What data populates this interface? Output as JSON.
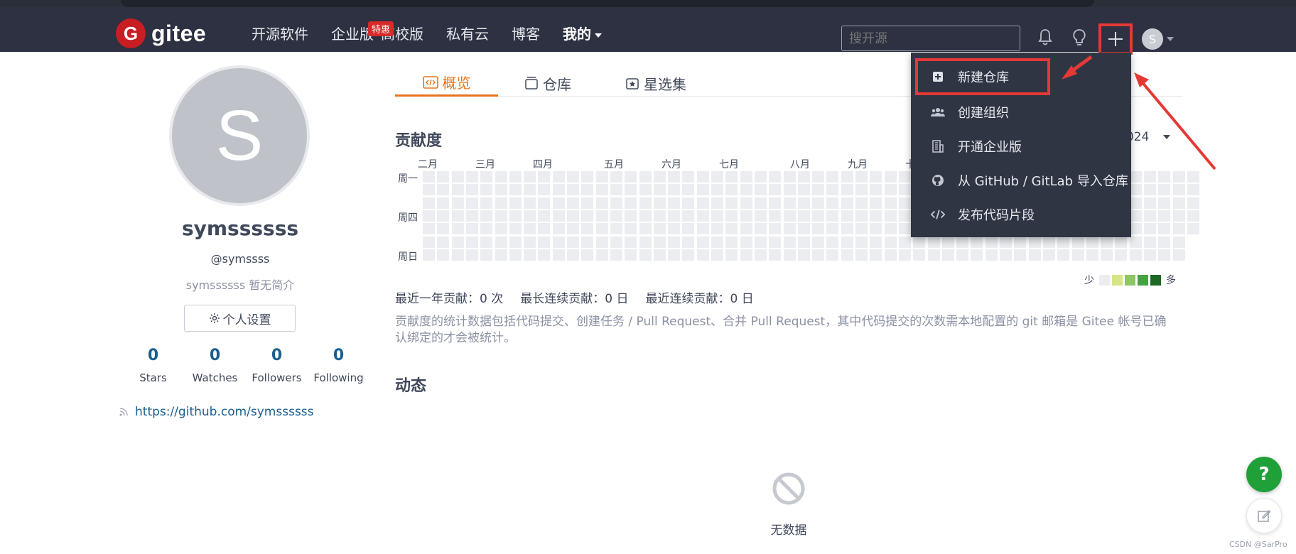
{
  "brand": {
    "name": "gitee",
    "logo_letter": "G"
  },
  "nav": {
    "items": [
      "开源软件",
      "企业版",
      "高校版",
      "私有云",
      "博客",
      "我的"
    ],
    "special_badge": "特惠"
  },
  "search": {
    "placeholder": "搜开源"
  },
  "user_avatar_letter": "S",
  "profile": {
    "avatar_letter": "S",
    "name": "symssssss",
    "handle": "@symssss",
    "bio": "symssssss 暂无简介",
    "settings_label": "个人设置",
    "stats": [
      {
        "num": "0",
        "label": "Stars"
      },
      {
        "num": "0",
        "label": "Watches"
      },
      {
        "num": "0",
        "label": "Followers"
      },
      {
        "num": "0",
        "label": "Following"
      }
    ],
    "link": "https://github.com/symssssss"
  },
  "tabs": [
    "概览",
    "仓库",
    "星选集"
  ],
  "contrib": {
    "title": "贡献度",
    "year": "2024",
    "months": [
      "二月",
      "三月",
      "四月",
      "五月",
      "六月",
      "七月",
      "八月",
      "九月",
      "十"
    ],
    "day_labels": [
      "周一",
      "周四",
      "周日"
    ],
    "legend_less": "少",
    "legend_more": "多",
    "legend_colors": [
      "#ebedf0",
      "#d6e685",
      "#8cc665",
      "#44a340",
      "#1e6823"
    ],
    "summary": [
      "最近一年贡献：0 次",
      "最长连续贡献：0 日",
      "最近连续贡献：0 日"
    ],
    "note": "贡献度的统计数据包括代码提交、创建任务 / Pull Request、合并 Pull Request，其中代码提交的次数需本地配置的 git 邮箱是 Gitee 帐号已确认绑定的才会被统计。"
  },
  "activity": {
    "title": "动态",
    "empty": "无数据"
  },
  "dropdown": {
    "items": [
      {
        "label": "新建仓库",
        "icon": "plus-square-icon"
      },
      {
        "label": "创建组织",
        "icon": "group-icon"
      },
      {
        "label": "开通企业版",
        "icon": "building-icon"
      },
      {
        "label": "从 GitHub / GitLab 导入仓库",
        "icon": "github-icon"
      },
      {
        "label": "发布代码片段",
        "icon": "code-icon"
      }
    ]
  },
  "help_label": "?",
  "watermark": "CSDN @SarPro"
}
